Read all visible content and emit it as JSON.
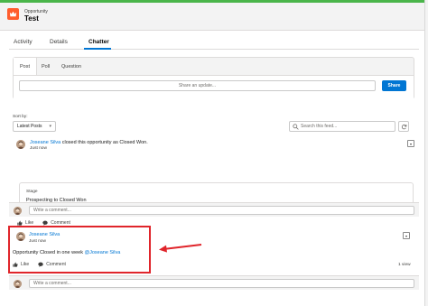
{
  "header": {
    "object_label": "Opportunity",
    "record_title": "Test"
  },
  "tabs": [
    {
      "label": "Activity"
    },
    {
      "label": "Details"
    },
    {
      "label": "Chatter"
    }
  ],
  "publisher": {
    "tabs": [
      {
        "label": "Post"
      },
      {
        "label": "Poll"
      },
      {
        "label": "Question"
      }
    ],
    "input_placeholder": "Share an update...",
    "share_label": "Share"
  },
  "feed_controls": {
    "sort_label": "Sort by:",
    "sort_value": "Latest Posts",
    "search_placeholder": "Search this feed..."
  },
  "posts": [
    {
      "author": "Joseane Silva",
      "action_text": " closed this opportunity as Closed Won.",
      "time": "Just now",
      "field_label": "Stage",
      "field_value": "Prospecting to Closed Won",
      "like_label": "Like",
      "comment_label": "Comment",
      "comment_placeholder": "Write a comment..."
    },
    {
      "author": "Joseane Silva",
      "time": "Just now",
      "body_prefix": "Opportunity Closed in one week ",
      "mention": "@Joseane Silva",
      "like_label": "Like",
      "comment_label": "Comment",
      "view_count": "1 view",
      "comment_placeholder": "Write a comment..."
    }
  ],
  "colors": {
    "accent": "#0176d3",
    "object_icon": "#ff5d2d",
    "highlight": "#e0252b"
  }
}
